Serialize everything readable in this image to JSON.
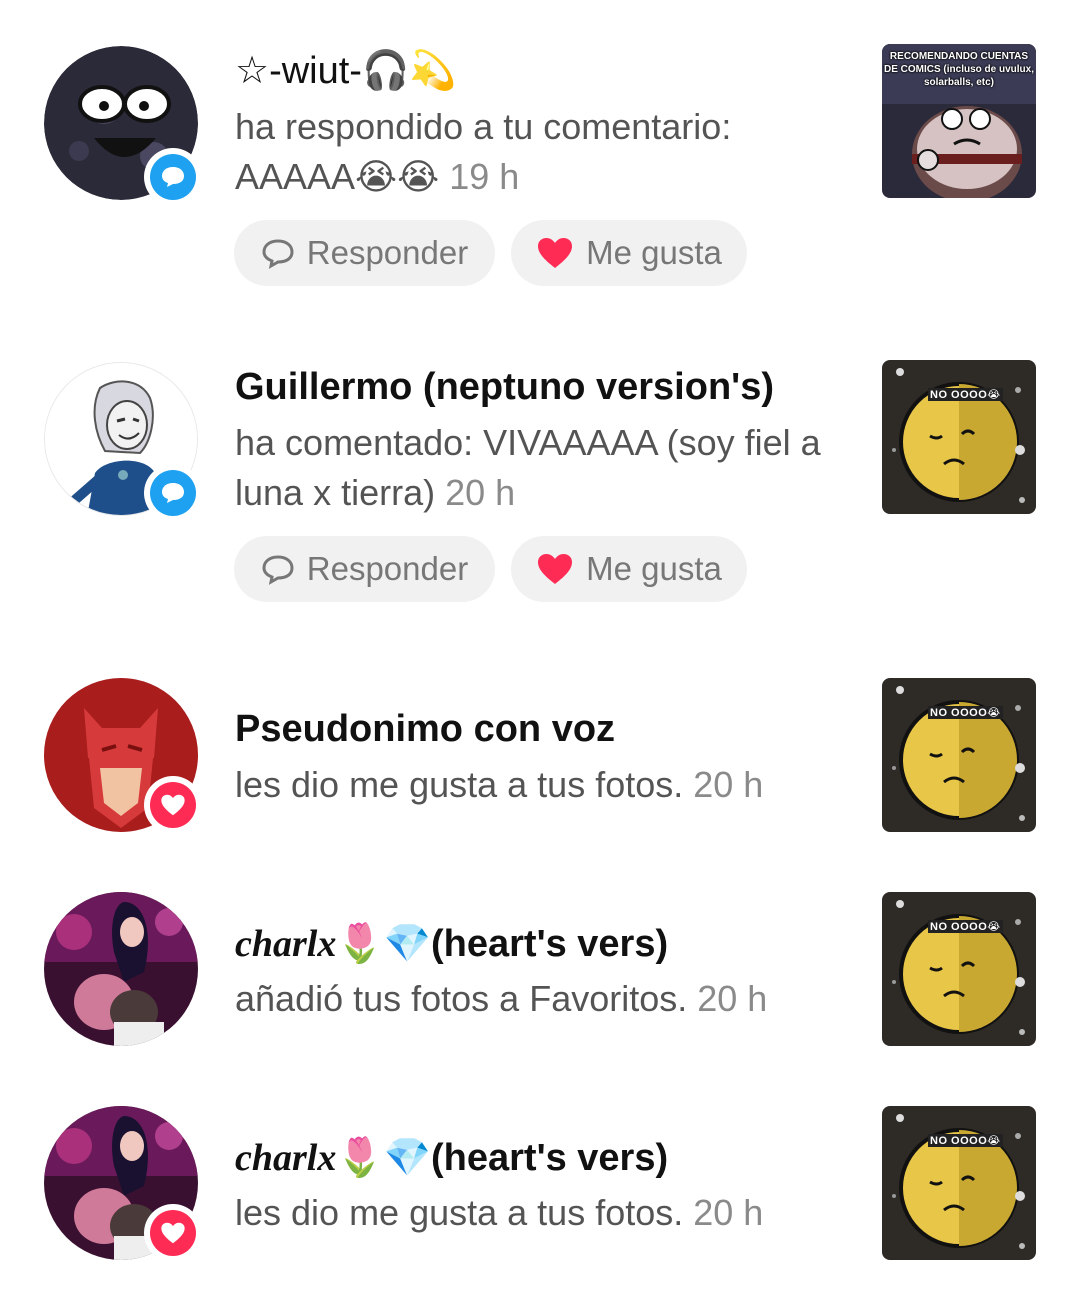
{
  "notifications": [
    {
      "name": "☆-wiut-🎧💫",
      "action": "ha respondido a tu comentario: AAAAA😭😭",
      "time": "19 h",
      "badge": "comment-icon",
      "thumb_caption": "RECOMENDANDO CUENTAS DE COMICS (incluso de uvulux, solarballs, etc)",
      "reply_label": "Responder",
      "like_label": "Me gusta"
    },
    {
      "name": "Guillermo (neptuno version's)",
      "action": "ha comentado: VIVAAAAA (soy fiel a luna x tierra)",
      "time": "20 h",
      "badge": "comment-icon",
      "thumb_caption": "NO OOOO😭",
      "reply_label": "Responder",
      "like_label": "Me gusta"
    },
    {
      "name": "Pseudonimo con voz",
      "action": "les dio me gusta a tus fotos.",
      "time": "20 h",
      "badge": "heart-icon",
      "thumb_caption": "NO OOOO😭"
    },
    {
      "name_script": "charlx",
      "name_rest": "🌷💎(heart's vers)",
      "action": "añadió tus fotos a Favoritos.",
      "time": "20 h",
      "badge": "heart-icon",
      "thumb_caption": "NO OOOO😭"
    },
    {
      "name_script": "charlx",
      "name_rest": "🌷💎(heart's vers)",
      "action": "les dio me gusta a tus fotos.",
      "time": "20 h",
      "badge": "heart-icon",
      "thumb_caption": "NO OOOO😭"
    }
  ],
  "colors": {
    "comment_badge": "#1ea1f1",
    "like_badge": "#fe2c55",
    "heart": "#fe2c55",
    "pill_bg": "#f1f1f2"
  }
}
